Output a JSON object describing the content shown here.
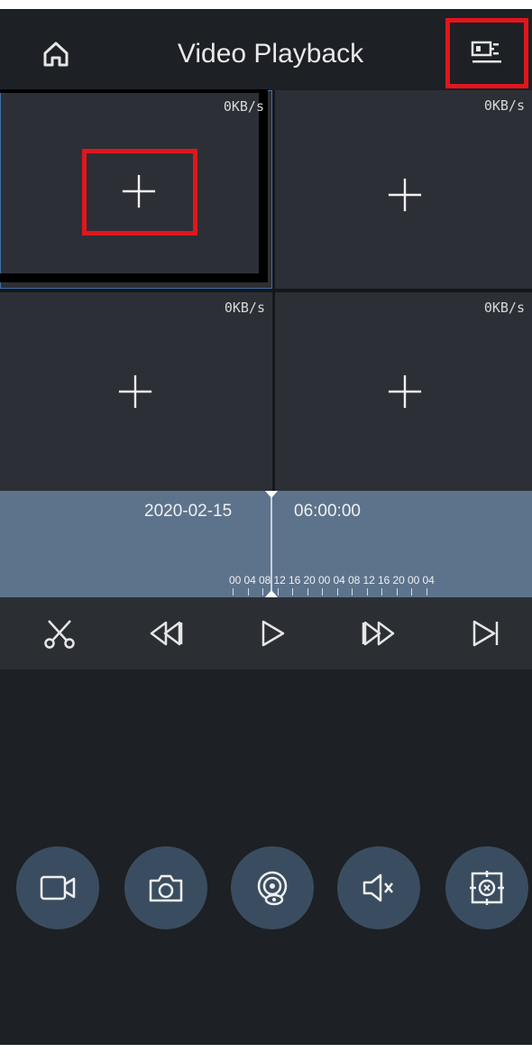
{
  "header": {
    "title": "Video Playback",
    "home_icon": "home-icon",
    "settings_icon": "playback-settings-icon"
  },
  "grid": {
    "cells": [
      {
        "speed": "0KB/s",
        "icon": "add-icon"
      },
      {
        "speed": "0KB/s",
        "icon": "add-icon"
      },
      {
        "speed": "0KB/s",
        "icon": "add-icon"
      },
      {
        "speed": "0KB/s",
        "icon": "add-icon"
      }
    ]
  },
  "timeline": {
    "date": "2020-02-15",
    "time": "06:00:00",
    "ticks": [
      "00",
      "04",
      "08",
      "12",
      "16",
      "20",
      "00",
      "04",
      "08",
      "12",
      "16",
      "20",
      "00",
      "04"
    ]
  },
  "controls": [
    {
      "icon": "scissors-icon"
    },
    {
      "icon": "rewind-icon"
    },
    {
      "icon": "play-icon"
    },
    {
      "icon": "fast-forward-icon"
    },
    {
      "icon": "skip-next-icon"
    }
  ],
  "tools": [
    {
      "icon": "record-icon"
    },
    {
      "icon": "camera-icon"
    },
    {
      "icon": "fisheye-icon"
    },
    {
      "icon": "mute-icon"
    },
    {
      "icon": "zoom-icon"
    }
  ],
  "colors": {
    "background": "#1d2024",
    "highlight": "#e0161c",
    "timeline": "#5d738c",
    "tool_button": "#3a4d60"
  }
}
